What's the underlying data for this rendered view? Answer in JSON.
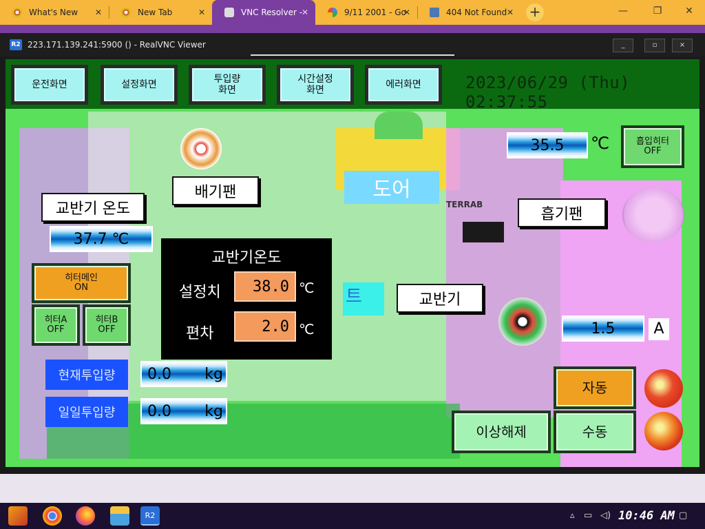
{
  "browser": {
    "tabs": [
      {
        "title": "What's New",
        "icon": "chrome-icon"
      },
      {
        "title": "New Tab",
        "icon": "chrome-icon"
      },
      {
        "title": "VNC Resolver -",
        "icon": "vnc-icon",
        "active": true
      },
      {
        "title": "9/11 2001 - Go",
        "icon": "google-icon"
      },
      {
        "title": "404 Not Found",
        "icon": "bitcoin-icon"
      }
    ],
    "new_tab": "+",
    "window_controls": [
      "—",
      "❐",
      "✕"
    ]
  },
  "vnc": {
    "title": "223.171.139.241:5900 () - RealVNC Viewer",
    "logo": "R2",
    "controls": [
      "_",
      "▫",
      "×"
    ]
  },
  "hmi": {
    "nav": [
      {
        "label": "운전화면"
      },
      {
        "label": "설정화면"
      },
      {
        "label": "투입량\n화면"
      },
      {
        "label": "시간설정\n화면"
      },
      {
        "label": "에러화면"
      }
    ],
    "datetime": "2023/06/29 (Thu) 02:37:55",
    "exhaust_fan_label": "배기팬",
    "door_label": "도어",
    "intake_fan_label": "흡기팬",
    "mixer_label": "교반기",
    "mixer_temp_label": "교반기 온도",
    "mixer_temp_value": "37.7 ℃",
    "intake_temp_value": "35.5",
    "intake_temp_unit": "℃",
    "intake_heater": "흡입히터\nOFF",
    "heater_main": "히터메인\nON",
    "heater_a": "히터A\nOFF",
    "heater_b": "히터B\nOFF",
    "current_value": "1.5",
    "current_unit": "A",
    "panel": {
      "title": "교반기온도",
      "setpoint_label": "설정치",
      "setpoint_value": "38.0",
      "deviation_label": "편차",
      "deviation_value": "2.0",
      "unit": "℃"
    },
    "current_input_label": "현재투입량",
    "current_input_value": "0.0",
    "daily_input_label": "일일투입량",
    "daily_input_value": "0.0",
    "weight_unit": "kg",
    "auto_button": "자동",
    "manual_button": "수동",
    "reset_button": "이상해제",
    "brand_text": "TERRAB"
  },
  "taskbar": {
    "clock": "10:46 AM",
    "icons": [
      "start-icon",
      "chrome-icon",
      "firefox-icon",
      "explorer-icon",
      "realvnc-icon"
    ]
  }
}
